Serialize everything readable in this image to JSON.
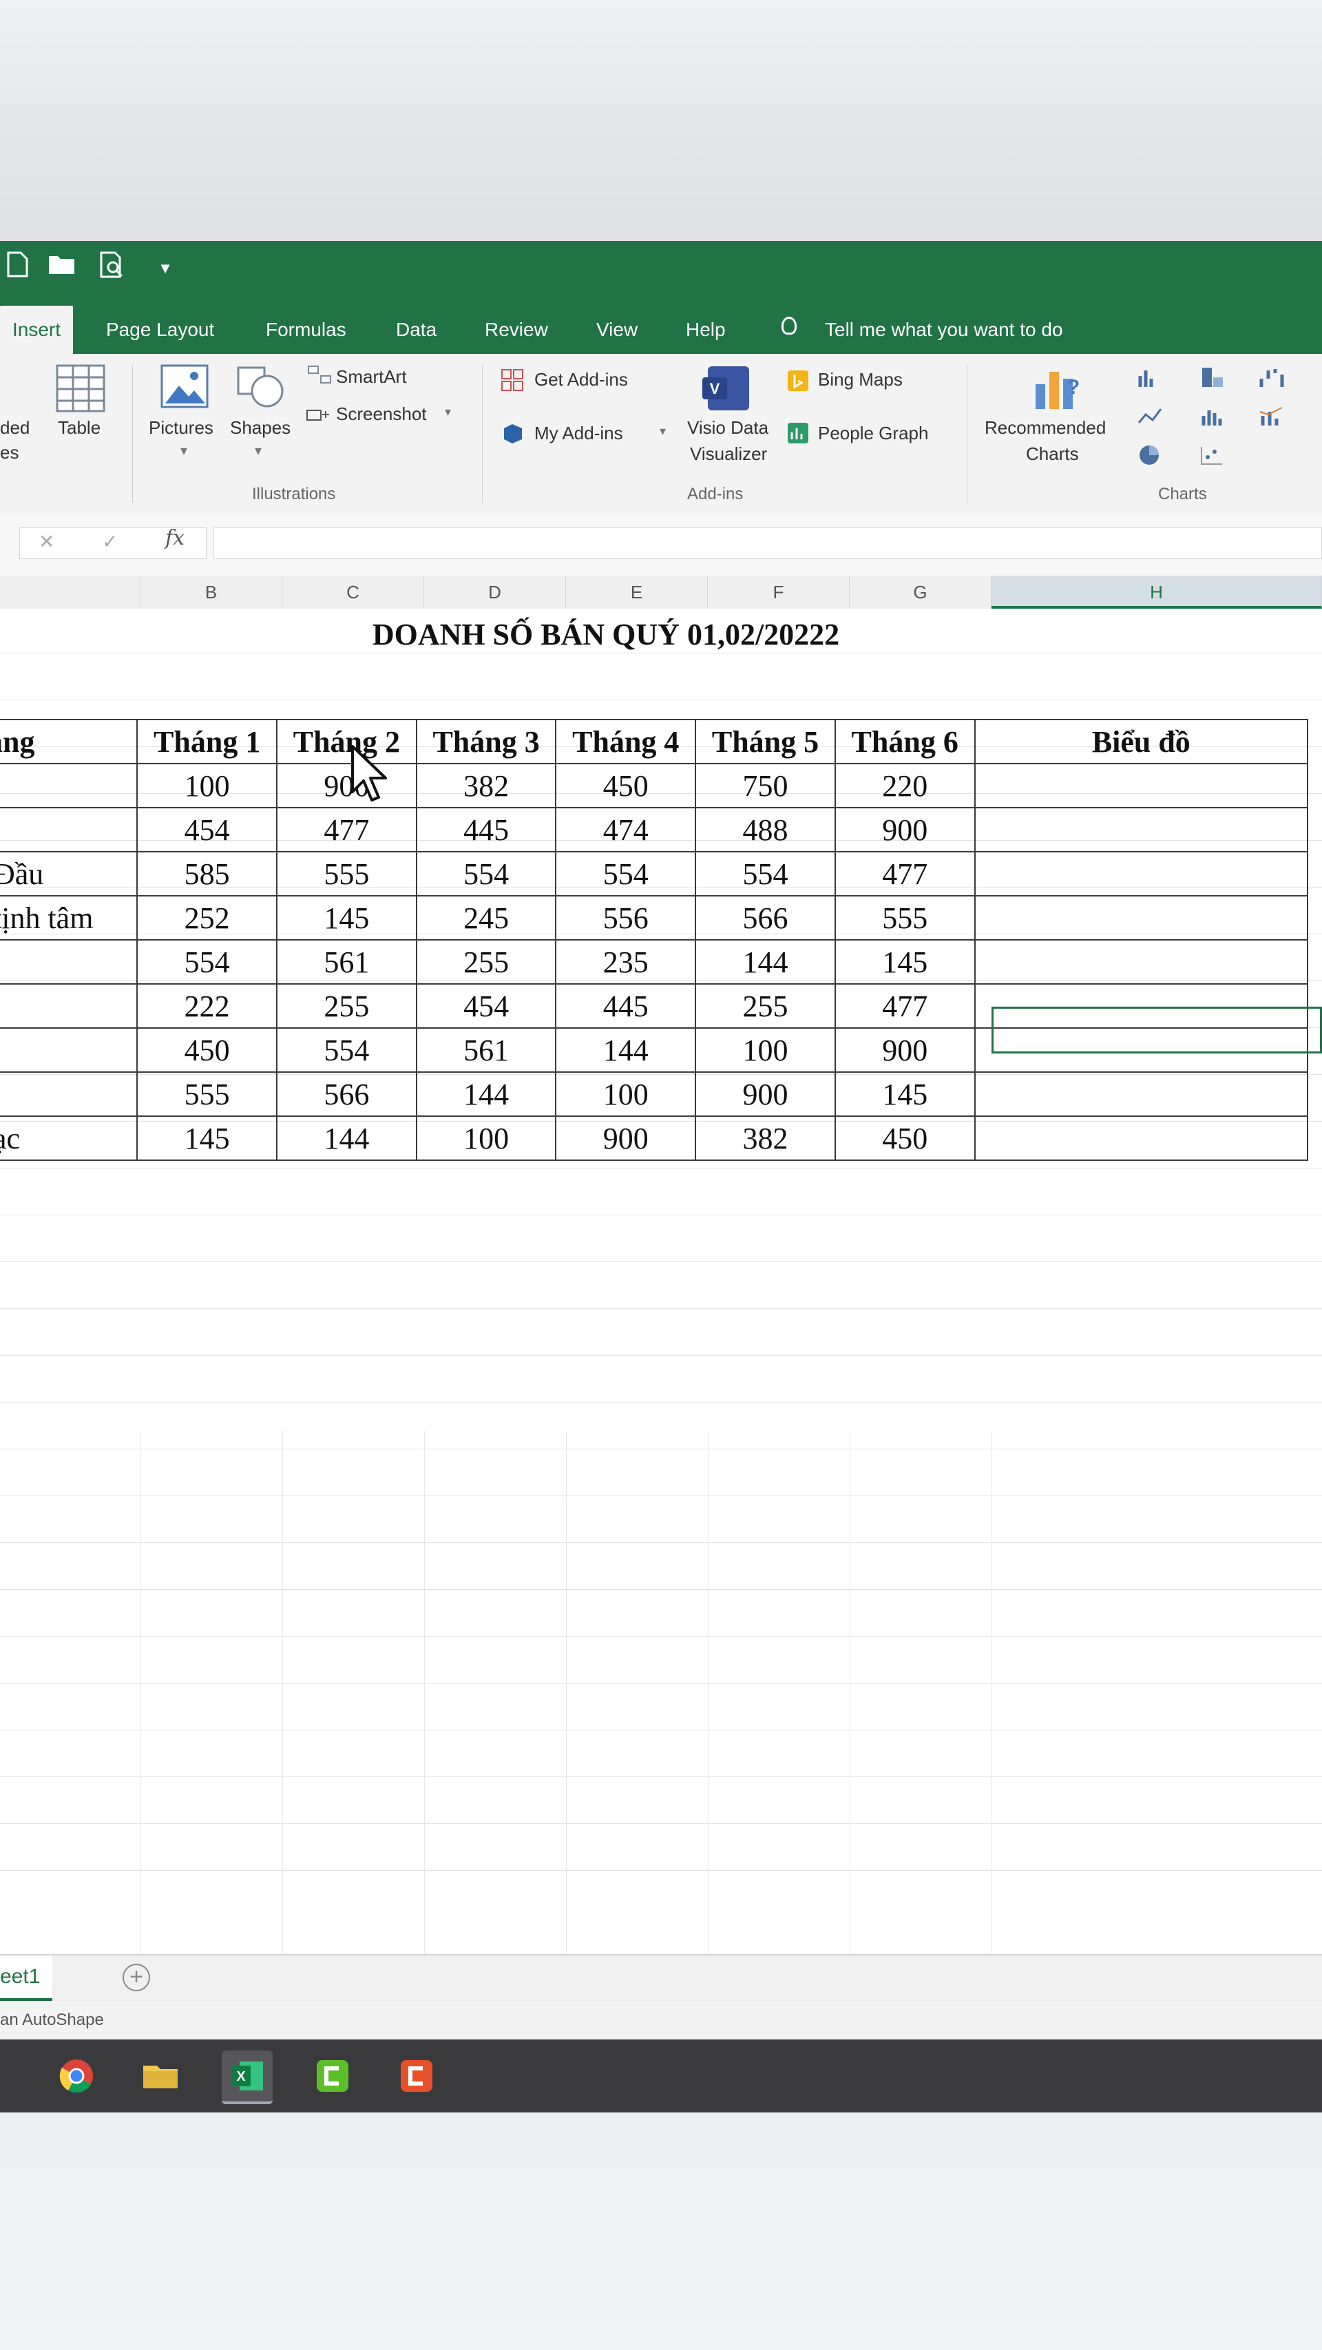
{
  "qat": {
    "new_icon": "new-file-icon",
    "open_icon": "folder-open-icon",
    "preview_icon": "print-preview-icon",
    "customize_icon": "dropdown-arrow-icon"
  },
  "tabs": [
    "Insert",
    "Page Layout",
    "Formulas",
    "Data",
    "Review",
    "View",
    "Help"
  ],
  "tell_me": "Tell me what you want to do",
  "ribbon": {
    "tables": {
      "partial_label_1": "ded",
      "partial_label_2": "es",
      "table": "Table"
    },
    "illustrations": {
      "pictures": "Pictures",
      "shapes": "Shapes",
      "smartart": "SmartArt",
      "screenshot": "Screenshot",
      "group_label": "Illustrations"
    },
    "addins": {
      "get_addins": "Get Add-ins",
      "my_addins": "My Add-ins",
      "visio_1": "Visio Data",
      "visio_2": "Visualizer",
      "bing_maps": "Bing Maps",
      "people_graph": "People Graph",
      "group_label": "Add-ins"
    },
    "charts": {
      "recommended_1": "Recommended",
      "recommended_2": "Charts",
      "group_label": "Charts"
    }
  },
  "formula_bar": {
    "fx": "fx",
    "cancel": "✕",
    "enter": "✓"
  },
  "columns": [
    "B",
    "C",
    "D",
    "E",
    "F",
    "G",
    "H"
  ],
  "sheet": {
    "title": "DOANH SỐ BÁN QUÝ 01,02/20222",
    "header": [
      "àng",
      "Tháng 1",
      "Tháng 2",
      "Tháng 3",
      "Tháng 4",
      "Tháng 5",
      "Tháng 6",
      "Biểu đồ"
    ],
    "rows": [
      {
        "name": "",
        "values": [
          "100",
          "900",
          "382",
          "450",
          "750",
          "220"
        ]
      },
      {
        "name": "",
        "values": [
          "454",
          "477",
          "445",
          "474",
          "488",
          "900"
        ]
      },
      {
        "name": " Đầu",
        "values": [
          "585",
          "555",
          "554",
          "554",
          "554",
          "477"
        ]
      },
      {
        "name": " tịnh tâm",
        "values": [
          "252",
          "145",
          "245",
          "556",
          "566",
          "555"
        ]
      },
      {
        "name": "",
        "values": [
          "554",
          "561",
          "255",
          "235",
          "144",
          "145"
        ]
      },
      {
        "name": "",
        "values": [
          "222",
          "255",
          "454",
          "445",
          "255",
          "477"
        ]
      },
      {
        "name": "",
        "values": [
          "450",
          "554",
          "561",
          "144",
          "100",
          "900"
        ]
      },
      {
        "name": "",
        "values": [
          "555",
          "566",
          "144",
          "100",
          "900",
          "145"
        ]
      },
      {
        "name": "ạc",
        "values": [
          "145",
          "144",
          "100",
          "900",
          "382",
          "450"
        ]
      }
    ]
  },
  "sheet_tab": "eet1",
  "status": "an AutoShape",
  "taskbar_icons": [
    "chrome-icon",
    "file-explorer-icon",
    "excel-icon",
    "camtasia-icon",
    "camtasia-recorder-icon"
  ]
}
